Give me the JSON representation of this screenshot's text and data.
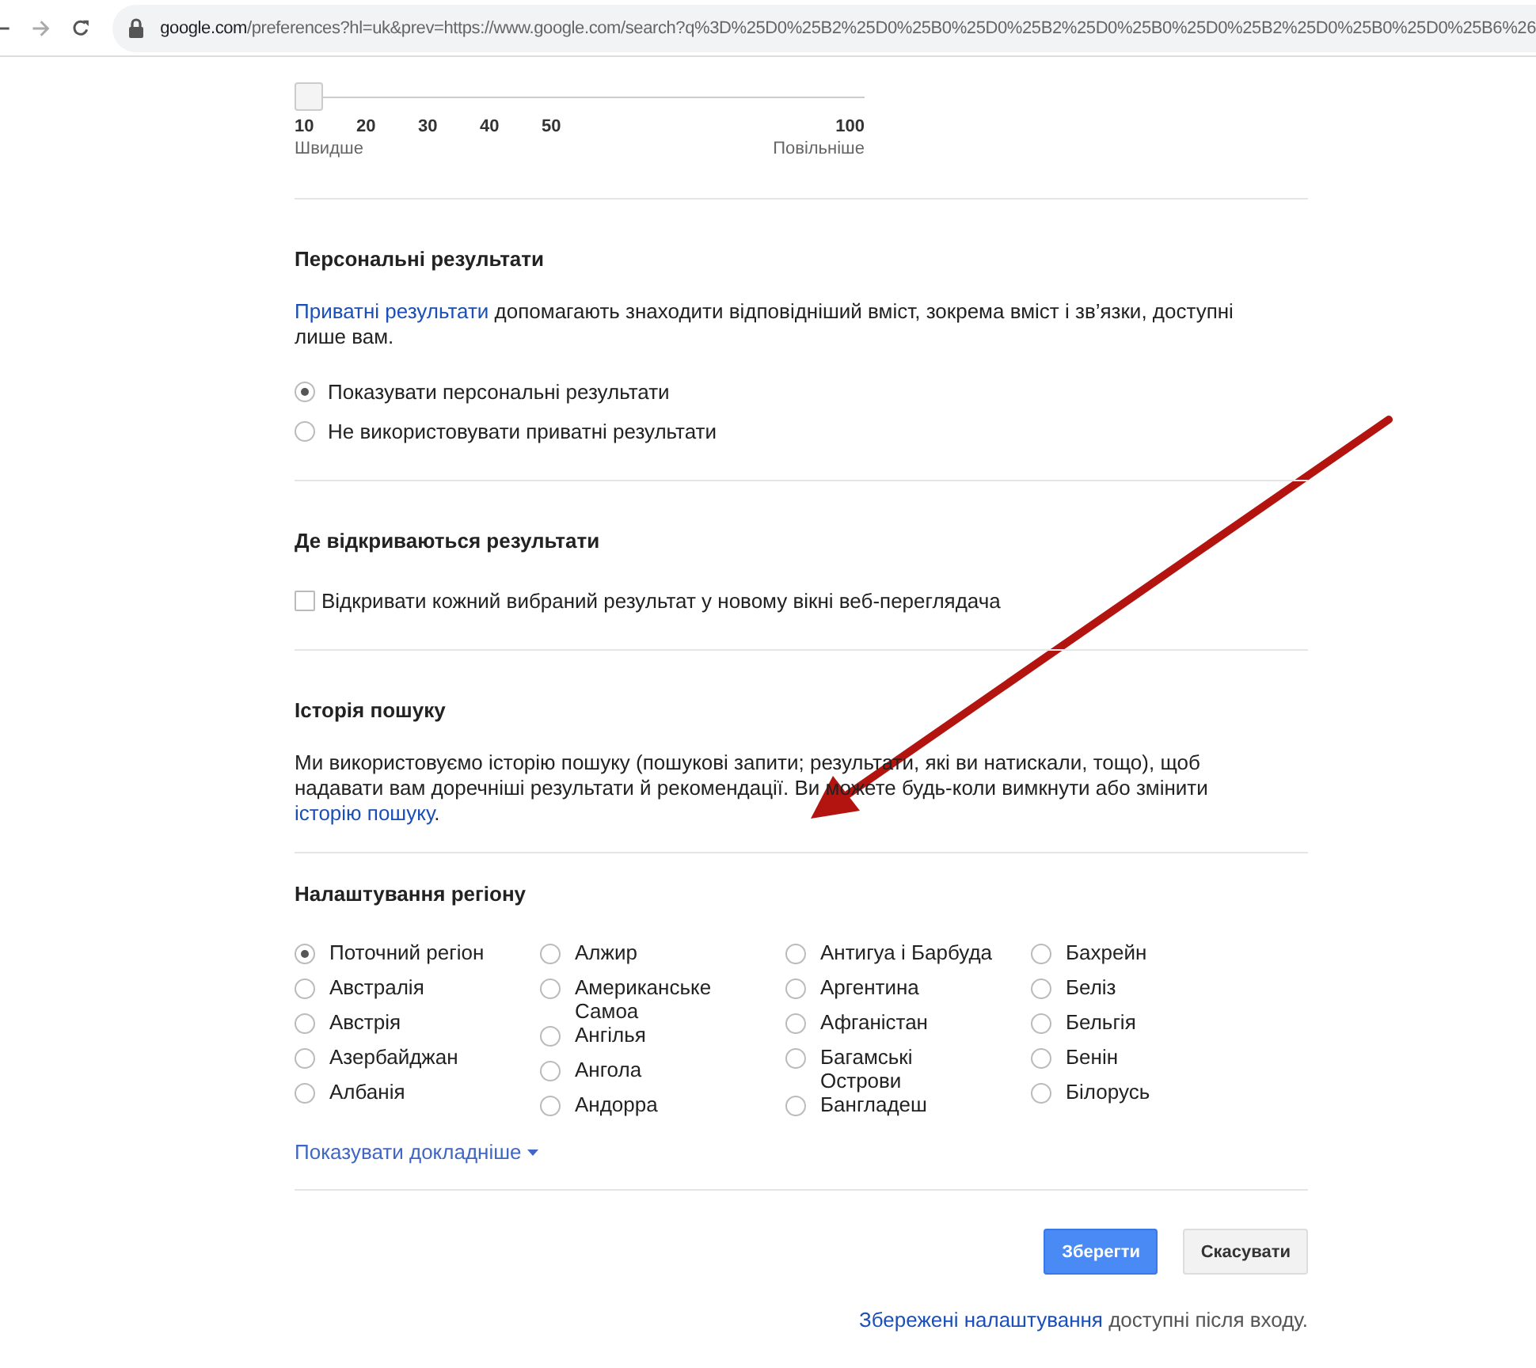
{
  "browser": {
    "url_host": "google.com",
    "url_rest": "/preferences?hl=uk&prev=https://www.google.com/search?q%3D%25D0%25B2%25D0%25B0%25D0%25B2%25D0%25B0%25D0%25B2%25D0%25B0%25D0%25B6%26"
  },
  "slider": {
    "level": 0,
    "ticks": [
      "10",
      "20",
      "30",
      "40",
      "50",
      "100"
    ],
    "min_label": "Швидше",
    "max_label": "Повільніше"
  },
  "sections": [
    {
      "kind": "radio",
      "title": "Персональні результати",
      "link": "Приватні результати",
      "text": " допомагають знаходити відповідніший вміст, зокрема вміст і зв’язки, доступні лише вам.",
      "options": [
        {
          "label": "Показувати персональні результати",
          "selected": true
        },
        {
          "label": "Не використовувати приватні результати",
          "selected": false
        }
      ]
    },
    {
      "kind": "checkbox",
      "title": "Де відкриваються результати",
      "options": [
        {
          "label": "Відкривати кожний вибраний результат у новому вікні веб-переглядача",
          "checked": false
        }
      ]
    },
    {
      "kind": "text",
      "title": "Історія пошуку",
      "text": "Ми використовуємо історію пошуку (пошукові запити; результати, які ви натискали, тощо), щоб надавати вам доречніші результати й рекомендації. Ви можете будь-коли вимкнути або змінити ",
      "link": "історію пошуку",
      "text_after": "."
    }
  ],
  "region": {
    "title": "Налаштування регіону",
    "columns": [
      [
        {
          "label": "Поточний регіон",
          "selected": true
        },
        {
          "label": "Австралія",
          "selected": false
        },
        {
          "label": "Австрія",
          "selected": false
        },
        {
          "label": "Азербайджан",
          "selected": false
        },
        {
          "label": "Албанія",
          "selected": false
        }
      ],
      [
        {
          "label": "Алжир",
          "selected": false
        },
        {
          "label": "Американське Самоа",
          "selected": false
        },
        {
          "label": "Ангілья",
          "selected": false
        },
        {
          "label": "Ангола",
          "selected": false
        },
        {
          "label": "Андорра",
          "selected": false
        }
      ],
      [
        {
          "label": "Антигуа і Барбуда",
          "selected": false
        },
        {
          "label": "Аргентина",
          "selected": false
        },
        {
          "label": "Афганістан",
          "selected": false
        },
        {
          "label": "Багамські Острови",
          "selected": false
        },
        {
          "label": "Бангладеш",
          "selected": false
        }
      ],
      [
        {
          "label": "Бахрейн",
          "selected": false
        },
        {
          "label": "Беліз",
          "selected": false
        },
        {
          "label": "Бельгія",
          "selected": false
        },
        {
          "label": "Бенін",
          "selected": false
        },
        {
          "label": "Білорусь",
          "selected": false
        }
      ]
    ],
    "more": "Показувати докладніше"
  },
  "buttons": [
    {
      "label": "Зберегти",
      "kind": "primary"
    },
    {
      "label": "Скасувати",
      "kind": "secondary"
    }
  ],
  "footer": {
    "link": "Збережені налаштування",
    "text": " доступні після входу."
  }
}
